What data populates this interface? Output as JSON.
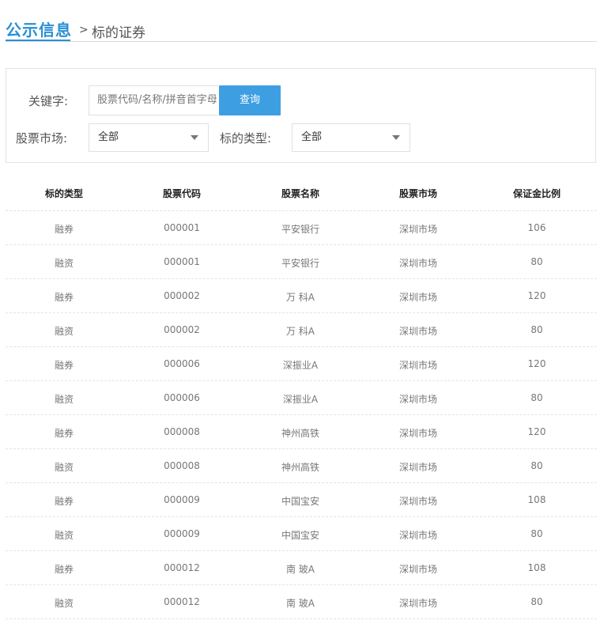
{
  "header": {
    "title": "公示信息",
    "separator": ">",
    "breadcrumb": "标的证券"
  },
  "search": {
    "keyword_label": "关键字:",
    "keyword_placeholder": "股票代码/名称/拼音首字母",
    "search_button": "查询",
    "market_label": "股票市场:",
    "market_value": "全部",
    "type_label": "标的类型:",
    "type_value": "全部"
  },
  "table": {
    "columns": [
      "标的类型",
      "股票代码",
      "股票名称",
      "股票市场",
      "保证金比例"
    ],
    "rows": [
      [
        "融券",
        "000001",
        "平安银行",
        "深圳市场",
        "106"
      ],
      [
        "融资",
        "000001",
        "平安银行",
        "深圳市场",
        "80"
      ],
      [
        "融券",
        "000002",
        "万 科A",
        "深圳市场",
        "120"
      ],
      [
        "融资",
        "000002",
        "万 科A",
        "深圳市场",
        "80"
      ],
      [
        "融券",
        "000006",
        "深振业A",
        "深圳市场",
        "120"
      ],
      [
        "融资",
        "000006",
        "深振业A",
        "深圳市场",
        "80"
      ],
      [
        "融券",
        "000008",
        "神州高铁",
        "深圳市场",
        "120"
      ],
      [
        "融资",
        "000008",
        "神州高铁",
        "深圳市场",
        "80"
      ],
      [
        "融券",
        "000009",
        "中国宝安",
        "深圳市场",
        "108"
      ],
      [
        "融资",
        "000009",
        "中国宝安",
        "深圳市场",
        "80"
      ],
      [
        "融券",
        "000012",
        "南 玻A",
        "深圳市场",
        "108"
      ],
      [
        "融资",
        "000012",
        "南 玻A",
        "深圳市场",
        "80"
      ]
    ]
  },
  "colors": {
    "accent": "#2a8fd6",
    "button": "#3d9fe2"
  }
}
